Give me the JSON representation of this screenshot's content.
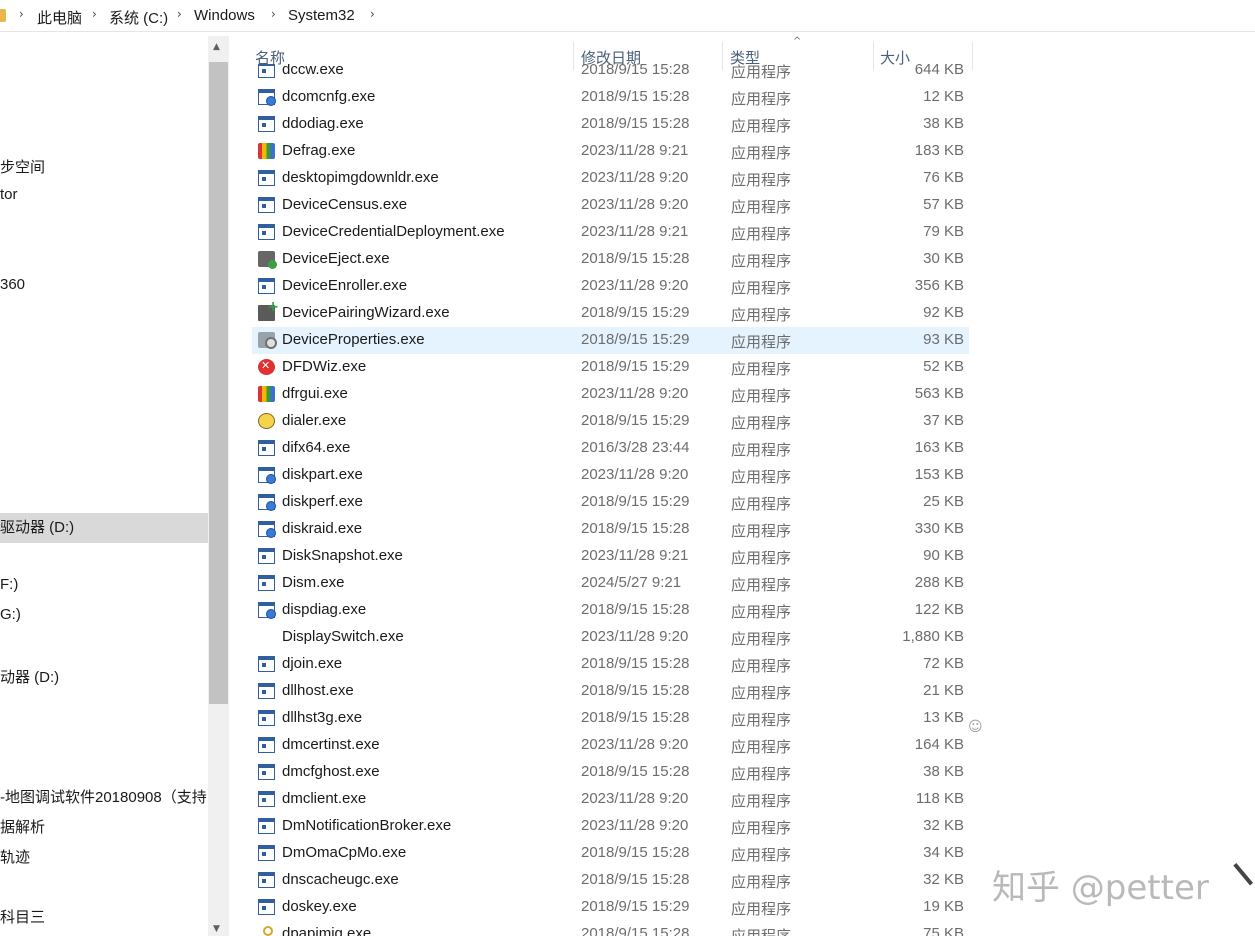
{
  "breadcrumb": [
    "此电脑",
    "系统 (C:)",
    "Windows",
    "System32"
  ],
  "nav_items": [
    {
      "label": "步空间"
    },
    {
      "label": "tor"
    },
    {
      "label": " 360"
    },
    {
      "label": "驱动器 (D:)"
    },
    {
      "label": "F:)"
    },
    {
      "label": "G:)"
    },
    {
      "label": "动器 (D:)"
    },
    {
      "label": "-地图调试软件20180908（支持"
    },
    {
      "label": "据解析"
    },
    {
      "label": "轨迹"
    },
    {
      "label": "科目三"
    }
  ],
  "columns": {
    "name": "名称",
    "date": "修改日期",
    "type": "类型",
    "size": "大小"
  },
  "files": [
    {
      "name": "dccw.exe",
      "date": "2018/9/15 15:28",
      "type": "应用程序",
      "size": "644 KB",
      "icon": "app-window-icon"
    },
    {
      "name": "dcomcnfg.exe",
      "date": "2018/9/15 15:28",
      "type": "应用程序",
      "size": "12 KB",
      "icon": "config-icon"
    },
    {
      "name": "ddodiag.exe",
      "date": "2018/9/15 15:28",
      "type": "应用程序",
      "size": "38 KB",
      "icon": "app-window-icon"
    },
    {
      "name": "Defrag.exe",
      "date": "2023/11/28 9:21",
      "type": "应用程序",
      "size": "183 KB",
      "icon": "defrag-icon"
    },
    {
      "name": "desktopimgdownldr.exe",
      "date": "2023/11/28 9:20",
      "type": "应用程序",
      "size": "76 KB",
      "icon": "app-window-icon"
    },
    {
      "name": "DeviceCensus.exe",
      "date": "2023/11/28 9:20",
      "type": "应用程序",
      "size": "57 KB",
      "icon": "app-window-icon"
    },
    {
      "name": "DeviceCredentialDeployment.exe",
      "date": "2023/11/28 9:21",
      "type": "应用程序",
      "size": "79 KB",
      "icon": "app-window-icon"
    },
    {
      "name": "DeviceEject.exe",
      "date": "2018/9/15 15:28",
      "type": "应用程序",
      "size": "30 KB",
      "icon": "eject-icon"
    },
    {
      "name": "DeviceEnroller.exe",
      "date": "2023/11/28 9:20",
      "type": "应用程序",
      "size": "356 KB",
      "icon": "app-window-icon"
    },
    {
      "name": "DevicePairingWizard.exe",
      "date": "2018/9/15 15:29",
      "type": "应用程序",
      "size": "92 KB",
      "icon": "pairing-icon"
    },
    {
      "name": "DeviceProperties.exe",
      "date": "2018/9/15 15:29",
      "type": "应用程序",
      "size": "93 KB",
      "icon": "properties-icon"
    },
    {
      "name": "DFDWiz.exe",
      "date": "2018/9/15 15:29",
      "type": "应用程序",
      "size": "52 KB",
      "icon": "error-icon"
    },
    {
      "name": "dfrgui.exe",
      "date": "2023/11/28 9:20",
      "type": "应用程序",
      "size": "563 KB",
      "icon": "defrag-icon"
    },
    {
      "name": "dialer.exe",
      "date": "2018/9/15 15:29",
      "type": "应用程序",
      "size": "37 KB",
      "icon": "dialer-icon"
    },
    {
      "name": "difx64.exe",
      "date": "2016/3/28 23:44",
      "type": "应用程序",
      "size": "163 KB",
      "icon": "app-window-icon"
    },
    {
      "name": "diskpart.exe",
      "date": "2023/11/28 9:20",
      "type": "应用程序",
      "size": "153 KB",
      "icon": "config-icon"
    },
    {
      "name": "diskperf.exe",
      "date": "2018/9/15 15:29",
      "type": "应用程序",
      "size": "25 KB",
      "icon": "config-icon"
    },
    {
      "name": "diskraid.exe",
      "date": "2018/9/15 15:28",
      "type": "应用程序",
      "size": "330 KB",
      "icon": "config-icon"
    },
    {
      "name": "DiskSnapshot.exe",
      "date": "2023/11/28 9:21",
      "type": "应用程序",
      "size": "90 KB",
      "icon": "app-window-icon"
    },
    {
      "name": "Dism.exe",
      "date": "2024/5/27 9:21",
      "type": "应用程序",
      "size": "288 KB",
      "icon": "app-window-icon"
    },
    {
      "name": "dispdiag.exe",
      "date": "2018/9/15 15:28",
      "type": "应用程序",
      "size": "122 KB",
      "icon": "config-icon"
    },
    {
      "name": "DisplaySwitch.exe",
      "date": "2023/11/28 9:20",
      "type": "应用程序",
      "size": "1,880 KB",
      "icon": "blank-icon"
    },
    {
      "name": "djoin.exe",
      "date": "2018/9/15 15:28",
      "type": "应用程序",
      "size": "72 KB",
      "icon": "app-window-icon"
    },
    {
      "name": "dllhost.exe",
      "date": "2018/9/15 15:28",
      "type": "应用程序",
      "size": "21 KB",
      "icon": "app-window-icon"
    },
    {
      "name": "dllhst3g.exe",
      "date": "2018/9/15 15:28",
      "type": "应用程序",
      "size": "13 KB",
      "icon": "app-window-icon"
    },
    {
      "name": "dmcertinst.exe",
      "date": "2023/11/28 9:20",
      "type": "应用程序",
      "size": "164 KB",
      "icon": "app-window-icon"
    },
    {
      "name": "dmcfghost.exe",
      "date": "2018/9/15 15:28",
      "type": "应用程序",
      "size": "38 KB",
      "icon": "app-window-icon"
    },
    {
      "name": "dmclient.exe",
      "date": "2023/11/28 9:20",
      "type": "应用程序",
      "size": "118 KB",
      "icon": "app-window-icon"
    },
    {
      "name": "DmNotificationBroker.exe",
      "date": "2023/11/28 9:20",
      "type": "应用程序",
      "size": "32 KB",
      "icon": "app-window-icon"
    },
    {
      "name": "DmOmaCpMo.exe",
      "date": "2018/9/15 15:28",
      "type": "应用程序",
      "size": "34 KB",
      "icon": "app-window-icon"
    },
    {
      "name": "dnscacheugc.exe",
      "date": "2018/9/15 15:28",
      "type": "应用程序",
      "size": "32 KB",
      "icon": "app-window-icon"
    },
    {
      "name": "doskey.exe",
      "date": "2018/9/15 15:29",
      "type": "应用程序",
      "size": "19 KB",
      "icon": "app-window-icon"
    },
    {
      "name": "dpapimig.exe",
      "date": "2018/9/15 15:28",
      "type": "应用程序",
      "size": "75 KB",
      "icon": "key-icon"
    }
  ],
  "selected_row": "DeviceProperties.exe",
  "watermark": "知乎 @petter",
  "colors": {
    "hover_row": "#e5f3ff",
    "header_text": "#4c607a",
    "muted_text": "#6d6d6d"
  }
}
